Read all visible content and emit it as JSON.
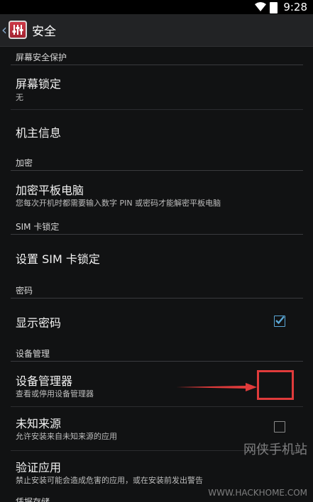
{
  "status": {
    "time": "9:28"
  },
  "header": {
    "title": "安全"
  },
  "sections": [
    {
      "label": "屏幕安全保护"
    },
    {
      "label": "加密"
    },
    {
      "label": "SIM 卡锁定"
    },
    {
      "label": "密码"
    },
    {
      "label": "设备管理"
    },
    {
      "label": "凭据存储"
    }
  ],
  "items": {
    "screen_lock": {
      "title": "屏幕锁定",
      "summary": "无"
    },
    "owner_info": {
      "title": "机主信息"
    },
    "encrypt": {
      "title": "加密平板电脑",
      "summary": "您每次开机时都需要输入数字 PIN 或密码才能解密平板电脑"
    },
    "sim_lock": {
      "title": "设置 SIM 卡锁定"
    },
    "show_password": {
      "title": "显示密码",
      "checked": true
    },
    "device_admin": {
      "title": "设备管理器",
      "summary": "查看或停用设备管理器"
    },
    "unknown_sources": {
      "title": "未知来源",
      "summary": "允许安装来自未知来源的应用",
      "checked": false
    },
    "verify_apps": {
      "title": "验证应用",
      "summary": "禁止安装可能会造成危害的应用，或在安装前发出警告"
    }
  },
  "watermark": {
    "brand": "网侠手机站",
    "url": "WWW.HACKHOME.COM"
  },
  "colors": {
    "accent": "#5aa7d6",
    "highlight": "#e03b3b"
  }
}
